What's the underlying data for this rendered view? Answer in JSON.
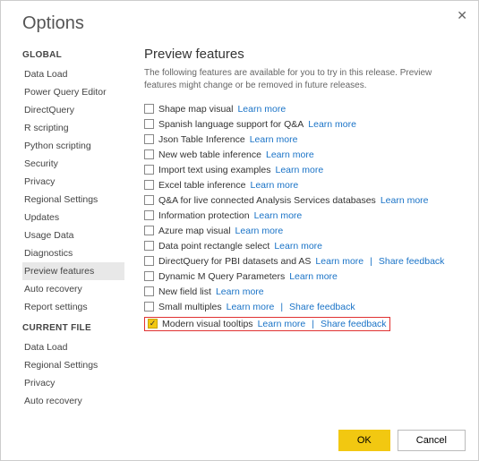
{
  "dialog": {
    "title": "Options"
  },
  "sidebar": {
    "sections": [
      {
        "title": "GLOBAL",
        "items": [
          "Data Load",
          "Power Query Editor",
          "DirectQuery",
          "R scripting",
          "Python scripting",
          "Security",
          "Privacy",
          "Regional Settings",
          "Updates",
          "Usage Data",
          "Diagnostics",
          "Preview features",
          "Auto recovery",
          "Report settings"
        ],
        "selected": "Preview features"
      },
      {
        "title": "CURRENT FILE",
        "items": [
          "Data Load",
          "Regional Settings",
          "Privacy",
          "Auto recovery"
        ],
        "selected": ""
      }
    ]
  },
  "main": {
    "heading": "Preview features",
    "description": "The following features are available for you to try in this release. Preview features might change or be removed in future releases.",
    "learn_more": "Learn more",
    "share_feedback": "Share feedback",
    "features": [
      {
        "label": "Shape map visual",
        "checked": false,
        "feedback": false,
        "highlight": false
      },
      {
        "label": "Spanish language support for Q&A",
        "checked": false,
        "feedback": false,
        "highlight": false
      },
      {
        "label": "Json Table Inference",
        "checked": false,
        "feedback": false,
        "highlight": false
      },
      {
        "label": "New web table inference",
        "checked": false,
        "feedback": false,
        "highlight": false
      },
      {
        "label": "Import text using examples",
        "checked": false,
        "feedback": false,
        "highlight": false
      },
      {
        "label": "Excel table inference",
        "checked": false,
        "feedback": false,
        "highlight": false
      },
      {
        "label": "Q&A for live connected Analysis Services databases",
        "checked": false,
        "feedback": false,
        "highlight": false
      },
      {
        "label": "Information protection",
        "checked": false,
        "feedback": false,
        "highlight": false
      },
      {
        "label": "Azure map visual",
        "checked": false,
        "feedback": false,
        "highlight": false
      },
      {
        "label": "Data point rectangle select",
        "checked": false,
        "feedback": false,
        "highlight": false
      },
      {
        "label": "DirectQuery for PBI datasets and AS",
        "checked": false,
        "feedback": true,
        "highlight": false
      },
      {
        "label": "Dynamic M Query Parameters",
        "checked": false,
        "feedback": false,
        "highlight": false
      },
      {
        "label": "New field list",
        "checked": false,
        "feedback": false,
        "highlight": false
      },
      {
        "label": "Small multiples",
        "checked": false,
        "feedback": true,
        "highlight": false
      },
      {
        "label": "Modern visual tooltips",
        "checked": true,
        "feedback": true,
        "highlight": true
      }
    ]
  },
  "buttons": {
    "ok": "OK",
    "cancel": "Cancel"
  }
}
